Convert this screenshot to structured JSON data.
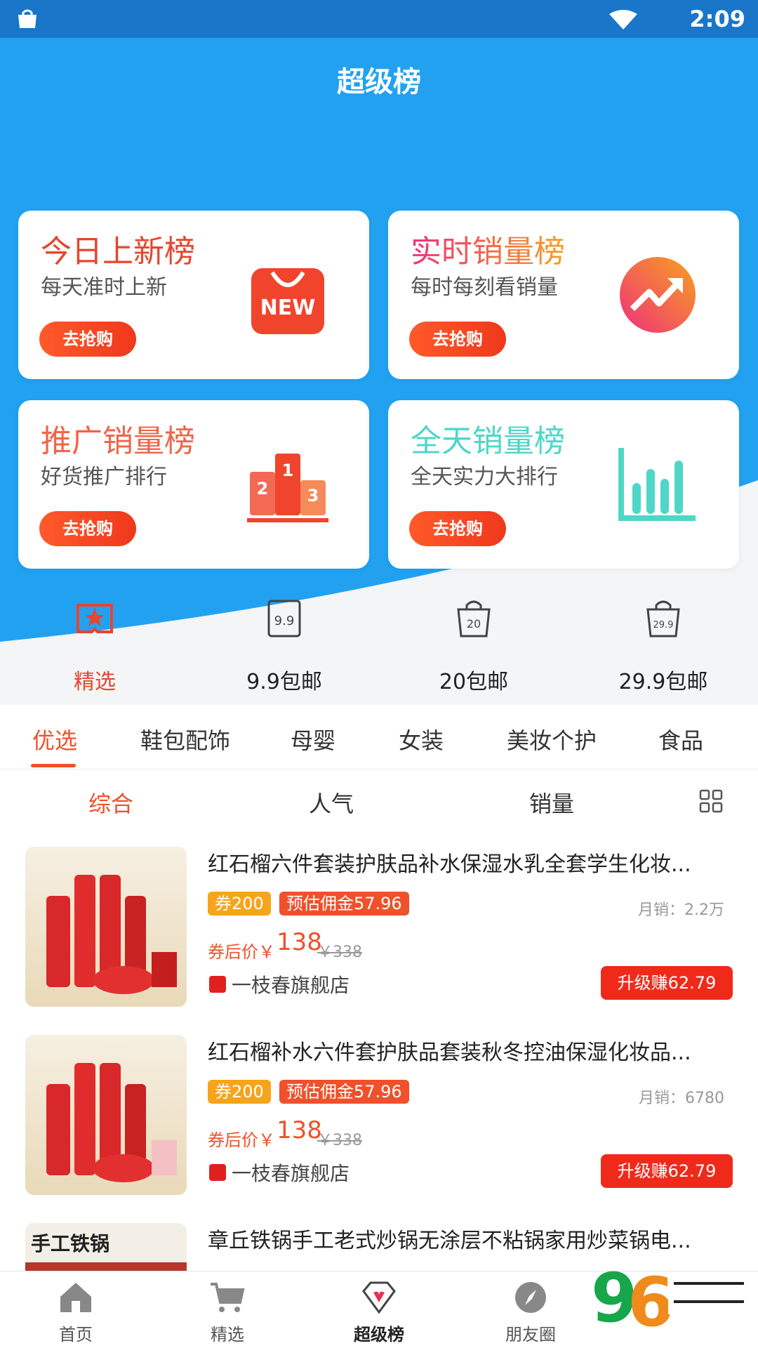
{
  "status": {
    "time": "2:09"
  },
  "header": {
    "title": "超级榜"
  },
  "cards": [
    {
      "title": "今日上新榜",
      "subtitle": "每天准时上新",
      "button": "去抢购",
      "icon": "new-bag-icon"
    },
    {
      "title": "实时销量榜",
      "subtitle": "每时每刻看销量",
      "button": "去抢购",
      "icon": "trend-up-icon"
    },
    {
      "title": "推广销量榜",
      "subtitle": "好货推广排行",
      "button": "去抢购",
      "icon": "podium-icon"
    },
    {
      "title": "全天销量榜",
      "subtitle": "全天实力大排行",
      "button": "去抢购",
      "icon": "bar-chart-icon"
    }
  ],
  "quick_nav": [
    {
      "label": "精选",
      "icon": "ribbon-star-icon",
      "active": true
    },
    {
      "label": "9.9包邮",
      "icon": "tag-9.9-icon"
    },
    {
      "label": "20包邮",
      "icon": "bag-20-icon"
    },
    {
      "label": "29.9包邮",
      "icon": "bag-29.9-icon"
    }
  ],
  "categories": [
    "优选",
    "鞋包配饰",
    "母婴",
    "女装",
    "美妆个护",
    "食品"
  ],
  "active_category": "优选",
  "sort": {
    "items": [
      "综合",
      "人气",
      "销量"
    ],
    "active": "综合"
  },
  "products": [
    {
      "title": "红石榴六件套装护肤品补水保湿水乳全套学生化妆...",
      "coupon": "券200",
      "commission": "预估佣金57.96",
      "monthly_sales": "月销：2.2万",
      "price_label": "券后价￥",
      "price": "138",
      "original_price": "￥338",
      "store": "一枝春旗舰店",
      "upgrade": "升级赚62.79"
    },
    {
      "title": "红石榴补水六件套护肤品套装秋冬控油保湿化妆品...",
      "coupon": "券200",
      "commission": "预估佣金57.96",
      "monthly_sales": "月销：6780",
      "price_label": "券后价￥",
      "price": "138",
      "original_price": "￥338",
      "store": "一枝春旗舰店",
      "upgrade": "升级赚62.79"
    },
    {
      "title": "章丘铁锅手工老式炒锅无涂层不粘锅家用炒菜锅电...",
      "thumb_text": "手工铁锅"
    }
  ],
  "tabbar": [
    {
      "label": "首页",
      "icon": "home-icon"
    },
    {
      "label": "精选",
      "icon": "cart-icon"
    },
    {
      "label": "超级榜",
      "icon": "diamond-heart-icon",
      "active": true
    },
    {
      "label": "朋友圈",
      "icon": "compass-icon"
    },
    {
      "label": "",
      "icon": "user-icon"
    }
  ],
  "colors": {
    "header_blue": "#22a1f1",
    "accent": "#f0502a",
    "coupon": "#f6a41a"
  }
}
